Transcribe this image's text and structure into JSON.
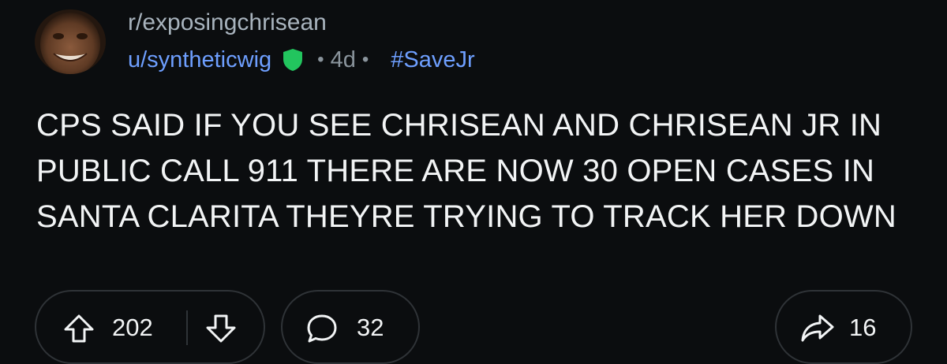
{
  "post": {
    "subreddit": "r/exposingchrisean",
    "author": "u/syntheticwig",
    "age": "4d",
    "flair": "#SaveJr",
    "title": "CPS SAID IF YOU SEE CHRISEAN AND CHRISEAN JR IN PUBLIC CALL 911 THERE ARE NOW 30 OPEN CASES IN SANTA CLARITA THEYRE TRYING TO TRACK HER DOWN"
  },
  "actions": {
    "score": "202",
    "comments": "32",
    "shares": "16"
  },
  "icons": {
    "avatar": "user-avatar",
    "badge": "shield-icon",
    "upvote": "arrow-up-icon",
    "downvote": "arrow-down-icon",
    "comment": "speech-bubble-icon",
    "share": "share-arrow-icon"
  },
  "colors": {
    "background": "#0b0d0f",
    "text": "#f2f4f5",
    "muted": "#a8b3bd",
    "link": "#6e9fff",
    "shield": "#22c55e",
    "border": "#2f3337"
  }
}
